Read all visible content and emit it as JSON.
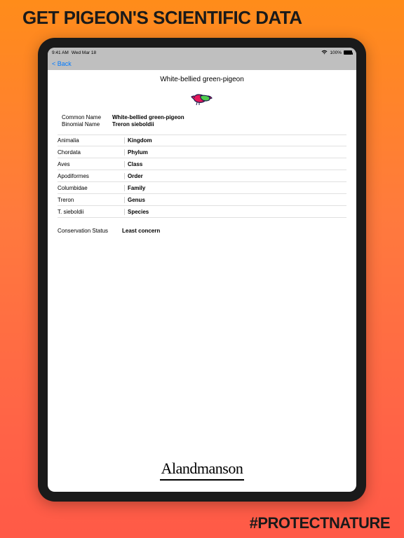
{
  "promo": {
    "headline": "GET PIGEON'S SCIENTIFIC DATA",
    "hashtag": "#PROTECTNATURE"
  },
  "statusbar": {
    "time": "9:41 AM",
    "date": "Wed Mar 18",
    "battery": "100%"
  },
  "nav": {
    "back": "< Back"
  },
  "page": {
    "title": "White-bellied green-pigeon"
  },
  "info": {
    "common_name_label": "Common Name",
    "common_name_value": "White-bellied green-pigeon",
    "binomial_name_label": "Binomial Name",
    "binomial_name_value": "Treron sieboldii"
  },
  "taxonomy": [
    {
      "value": "Animalia",
      "label": "Kingdom"
    },
    {
      "value": "Chordata",
      "label": "Phylum"
    },
    {
      "value": "Aves",
      "label": "Class"
    },
    {
      "value": "Apodiformes",
      "label": "Order"
    },
    {
      "value": "Columbidae",
      "label": "Family"
    },
    {
      "value": "Treron",
      "label": "Genus"
    },
    {
      "value": "T. sieboldii",
      "label": "Species"
    }
  ],
  "conservation": {
    "label": "Conservation Status",
    "value": "Least concern"
  },
  "author": "Alandmanson"
}
